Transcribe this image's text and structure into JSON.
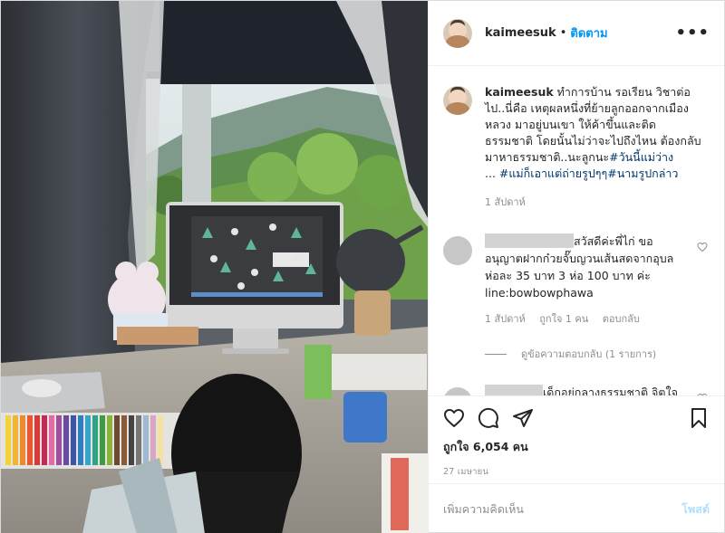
{
  "header": {
    "username": "kaimeesuk",
    "separator": "•",
    "follow_label": "ติดตาม",
    "more_label": "•••"
  },
  "caption": {
    "username": "kaimeesuk",
    "text": " ทำการบ้าน รอเรียน วิชาต่อไป..นี่คือ เหตุผลหนึ่งที่ย้ายลูกออกจากเมืองหลวง มาอยู่บนเขา ให้ค้าขึ้นและติดธรรมชาติ โดยนั้นไม่ว่าจะไปถึงไหน ต้องกลับมาหาธรรมชาติ..นะลูกนะ",
    "tag1": "#วันนี้แม่ว่าง",
    "ellipsis": "... ",
    "tag2": "#แม่ก็เอาแต่ถ่ายรูปๆๆ",
    "tag3": "#นามรูปกล่าว",
    "time": "1 สัปดาห์"
  },
  "comments": [
    {
      "text": "สวัสดีค่ะพี่ไก่ ขออนุญาตฝากก๋วยจั๊บญวนเส้นสดจากอุบล ห่อละ 35 บาท 3 ห่อ 100 บาท ค่ะ line:bowbowphawa",
      "time": "1 สัปดาห์",
      "likes": "ถูกใจ 1 คน",
      "reply_label": "ตอบกลับ",
      "view_replies": "ดูข้อความตอบกลับ (1 รายการ)"
    },
    {
      "text": "เด็กอยู่กลางธรรมชาติ จิตใจอ่อนโยน และเข้มแข็ง มองทุก"
    }
  ],
  "actions": {
    "like_icon": "heart-icon",
    "comment_icon": "comment-icon",
    "share_icon": "paper-plane-icon",
    "save_icon": "bookmark-icon"
  },
  "likes_text": "ถูกใจ 6,054 คน",
  "date": "27 เมษายน",
  "add_comment": {
    "placeholder": "เพิ่มความคิดเห็น",
    "post_label": "โพสต์"
  },
  "colors": {
    "link": "#0095f6",
    "tag": "#00376b",
    "muted": "#8e8e8e",
    "post_disabled": "#b2dffc"
  }
}
